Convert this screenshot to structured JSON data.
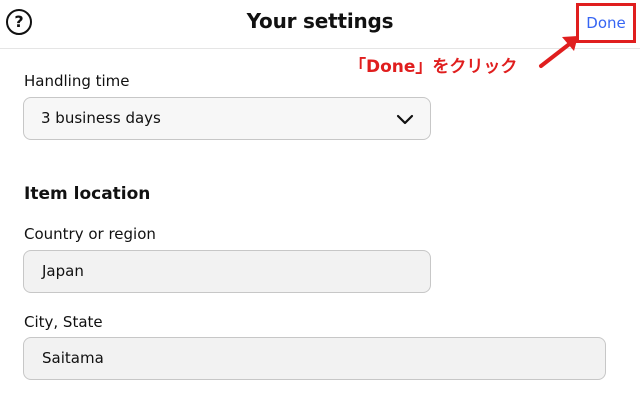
{
  "header": {
    "help_icon": "question-circle-icon",
    "help_glyph": "?",
    "title": "Your settings",
    "done_label": "Done"
  },
  "annotation": {
    "text": "「Done」をクリック",
    "color": "#e01e1e"
  },
  "handling": {
    "label": "Handling time",
    "value": "3 business days",
    "chevron_icon": "chevron-down-icon"
  },
  "item_location": {
    "heading": "Item location",
    "country_label": "Country or region",
    "country_value": "Japan",
    "city_label": "City, State",
    "city_value": "Saitama"
  },
  "colors": {
    "link_blue": "#3665f3",
    "highlight_red": "#e01e1e",
    "field_bg": "#f2f2f2",
    "border": "#c7c7c7"
  }
}
